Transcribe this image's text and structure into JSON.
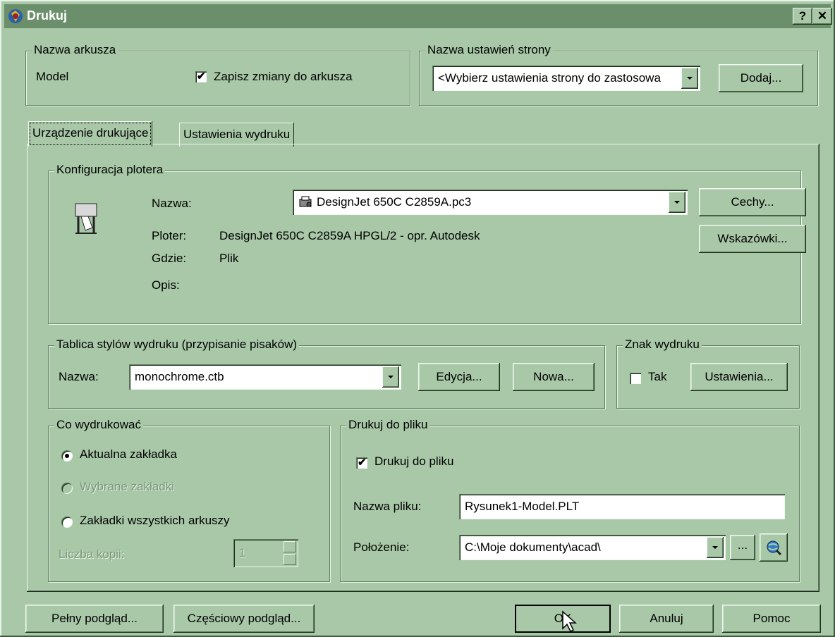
{
  "window": {
    "title": "Drukuj",
    "help_glyph": "?",
    "close_glyph": "✕"
  },
  "sheet_group": {
    "legend": "Nazwa arkusza",
    "sheet_name": "Model",
    "save_changes": {
      "label": "Zapisz zmiany do arkusza",
      "checked": true
    }
  },
  "page_setup_group": {
    "legend": "Nazwa ustawień strony",
    "combo_value": "<Wybierz ustawienia strony do zastosowa",
    "add_button": "Dodaj..."
  },
  "tabs": [
    {
      "label": "Urządzenie drukujące",
      "active": true
    },
    {
      "label": "Ustawienia wydruku",
      "active": false
    }
  ],
  "plotter": {
    "legend": "Konfiguracja plotera",
    "name_label": "Nazwa:",
    "name_value": "DesignJet 650C C2859A.pc3",
    "properties_button": "Cechy...",
    "hints_button": "Wskazówki...",
    "plotter_label": "Ploter:",
    "plotter_value": "DesignJet 650C C2859A HPGL/2 - opr. Autodesk",
    "where_label": "Gdzie:",
    "where_value": "Plik",
    "description_label": "Opis:"
  },
  "style_table": {
    "legend": "Tablica stylów wydruku (przypisanie pisaków)",
    "name_label": "Nazwa:",
    "name_value": "monochrome.ctb",
    "edit_button": "Edycja...",
    "new_button": "Nowa..."
  },
  "stamp": {
    "legend": "Znak wydruku",
    "yes_label": "Tak",
    "yes_checked": false,
    "settings_button": "Ustawienia..."
  },
  "what_to_plot": {
    "legend": "Co wydrukować",
    "current_tab": "Aktualna zakładka",
    "selected_tabs": "Wybrane zakładki",
    "all_tabs": "Zakładki wszystkich arkuszy",
    "copies_label": "Liczba kopii:",
    "copies_value": "1"
  },
  "plot_to_file": {
    "legend": "Drukuj do pliku",
    "checkbox_label": "Drukuj do pliku",
    "checked": true,
    "file_name_label": "Nazwa pliku:",
    "file_name_value": "Rysunek1-Model.PLT",
    "location_label": "Położenie:",
    "location_value": "C:\\Moje dokumenty\\acad\\",
    "browse_button": "..."
  },
  "footer": {
    "full_preview": "Pełny podgląd...",
    "partial_preview": "Częściowy podgląd...",
    "ok": "OK",
    "cancel": "Anuluj",
    "help": "Pomoc"
  }
}
